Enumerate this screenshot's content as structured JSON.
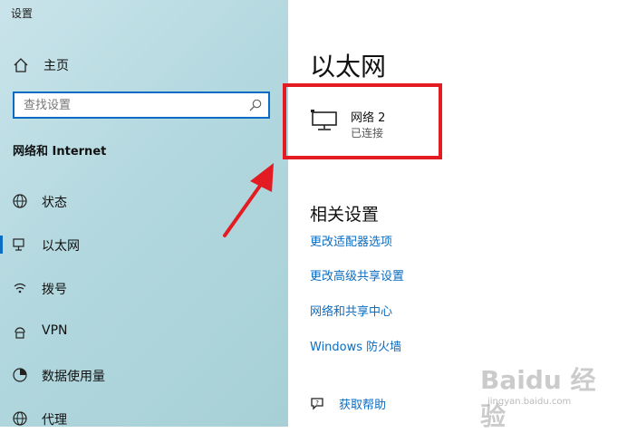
{
  "app": {
    "title": "设置"
  },
  "sidebar": {
    "home_label": "主页",
    "search": {
      "placeholder": "查找设置"
    },
    "section_title": "网络和 Internet",
    "items": [
      {
        "label": "状态",
        "icon": "globe-icon"
      },
      {
        "label": "以太网",
        "icon": "ethernet-icon",
        "selected": true
      },
      {
        "label": "拨号",
        "icon": "dialup-icon"
      },
      {
        "label": "VPN",
        "icon": "vpn-icon"
      },
      {
        "label": "数据使用量",
        "icon": "data-usage-icon"
      },
      {
        "label": "代理",
        "icon": "globe-icon"
      }
    ]
  },
  "main": {
    "title": "以太网",
    "network": {
      "name": "网络  2",
      "status": "已连接"
    },
    "related": {
      "title": "相关设置",
      "links": [
        "更改适配器选项",
        "更改高级共享设置",
        "网络和共享中心",
        "Windows 防火墙"
      ]
    },
    "help_label": "获取帮助"
  },
  "colors": {
    "accent": "#0a6cc2",
    "highlight": "#e31c23"
  },
  "watermark": {
    "brand": "Baidu 经验",
    "url": "jingyan.baidu.com"
  }
}
